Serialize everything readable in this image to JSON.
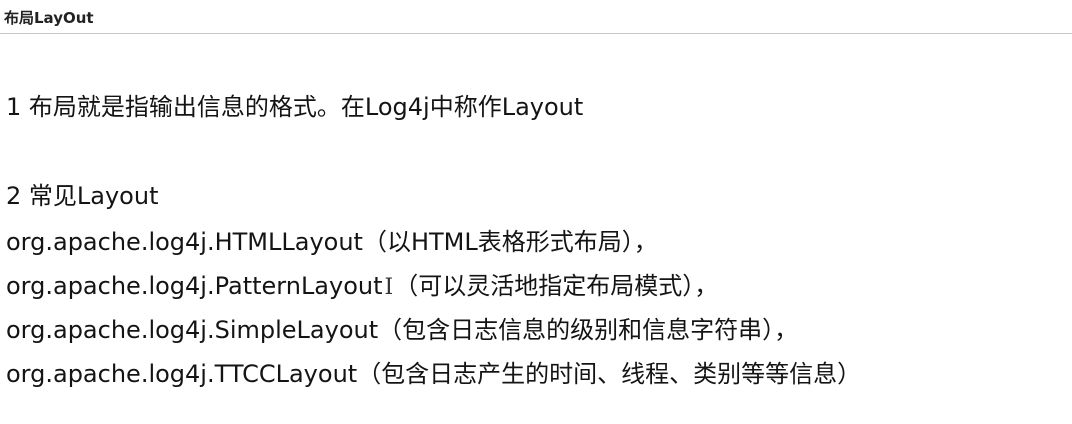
{
  "header": {
    "title": "布局LayOut"
  },
  "content": {
    "point1": "1 布局就是指输出信息的格式。在Log4j中称作Layout",
    "point2": "2 常见Layout",
    "layouts": [
      {
        "cls": "org.apache.log4j.HTMLLayout",
        "desc": "（以HTML表格形式布局），"
      },
      {
        "cls": "org.apache.log4j.PatternLayout",
        "desc": "（可以灵活地指定布局模式），"
      },
      {
        "cls": "org.apache.log4j.SimpleLayout",
        "desc": "（包含日志信息的级别和信息字符串），"
      },
      {
        "cls": "org.apache.log4j.TTCCLayout",
        "desc": "（包含日志产生的时间、线程、类别等等信息）"
      }
    ]
  },
  "cursor": {
    "glyph": "I",
    "icon": "text-cursor-icon"
  }
}
